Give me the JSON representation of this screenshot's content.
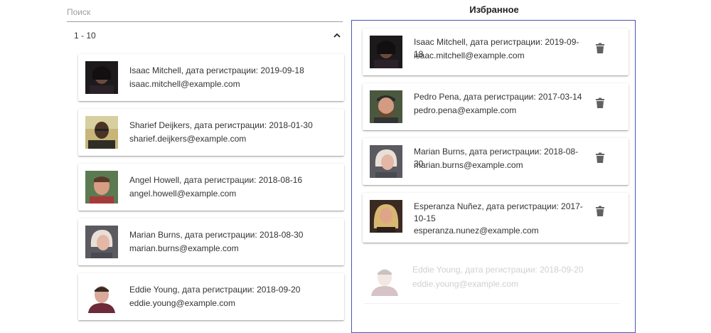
{
  "search": {
    "placeholder": "Поиск"
  },
  "range": {
    "label": "1 - 10",
    "toggle_icon": "chevron-up-icon"
  },
  "list": [
    {
      "name": "Isaac Mitchell, дата регистрации: 2019-09-18",
      "email": "isaac.mitchell@example.com"
    },
    {
      "name": "Sharief Deijkers, дата регистрации: 2018-01-30",
      "email": "sharief.deijkers@example.com"
    },
    {
      "name": "Angel Howell, дата регистрации: 2018-08-16",
      "email": "angel.howell@example.com"
    },
    {
      "name": "Marian Burns, дата регистрации: 2018-08-30",
      "email": "marian.burns@example.com"
    },
    {
      "name": "Eddie Young, дата регистрации: 2018-09-20",
      "email": "eddie.young@example.com"
    }
  ],
  "favorites": {
    "title": "Избранное",
    "accent_color": "#4655b8",
    "delete_icon": "trash-icon",
    "items": [
      {
        "name": "Isaac Mitchell, дата регистрации: 2019-09-18",
        "email": "isaac.mitchell@example.com"
      },
      {
        "name": "Pedro Pena, дата регистрации: 2017-03-14",
        "email": "pedro.pena@example.com"
      },
      {
        "name": "Marian Burns, дата регистрации: 2018-08-30",
        "email": "marian.burns@example.com"
      },
      {
        "name": "Esperanza Nuñez, дата регистрации: 2017-10-15",
        "email": "esperanza.nunez@example.com"
      }
    ],
    "dragging": {
      "name": "Eddie Young, дата регистрации: 2018-09-20",
      "email": "eddie.young@example.com"
    }
  }
}
